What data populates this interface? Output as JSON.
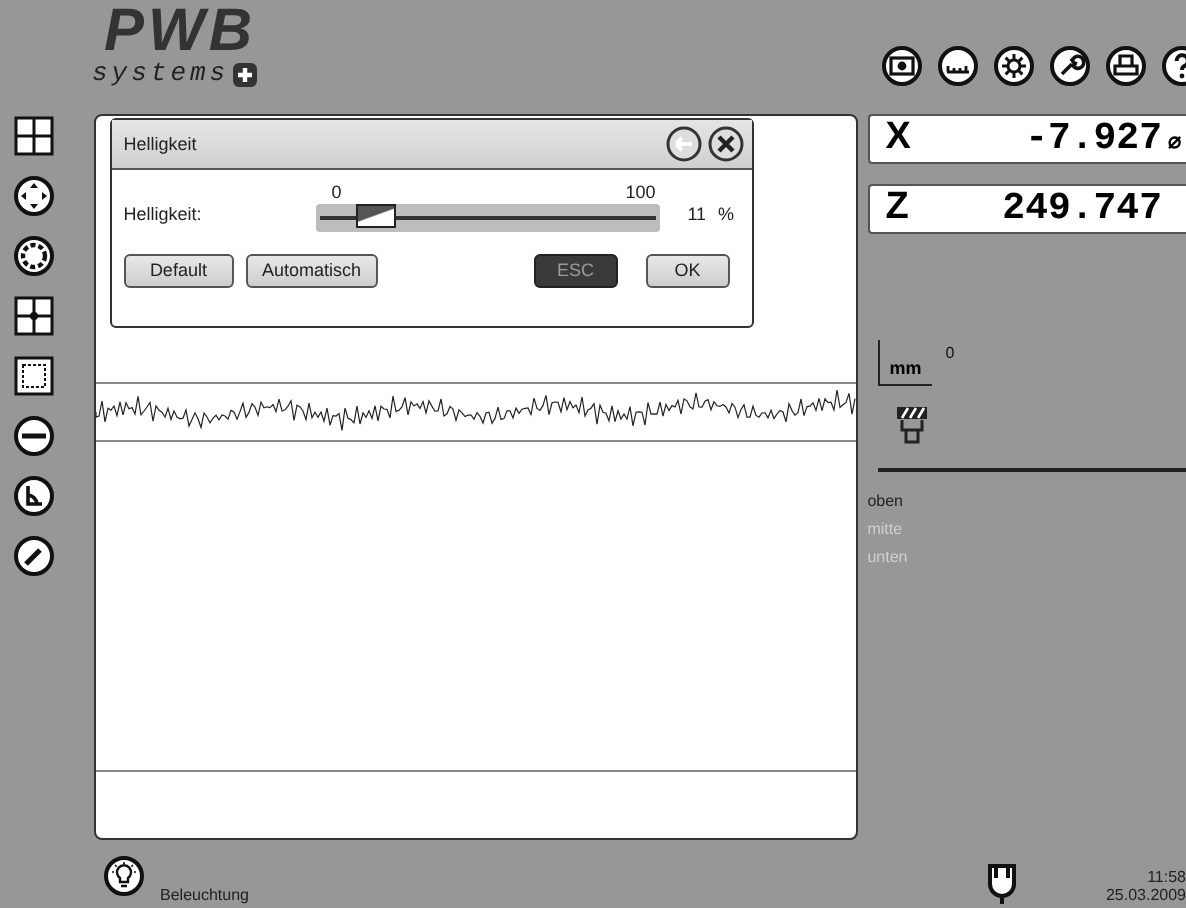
{
  "logo": {
    "brand": "PWB",
    "sub": "systems"
  },
  "dialog": {
    "title": "Helligkeit",
    "slider": {
      "label": "Helligkeit:",
      "min_label": "0",
      "max_label": "100",
      "level": 0.11,
      "reading": "11",
      "unit": "%"
    },
    "buttons": [
      {
        "label": "Default",
        "active": false
      },
      {
        "label": "Automatisch",
        "active": false
      },
      {
        "label": "ESC",
        "active": true
      },
      {
        "label": "OK",
        "active": false
      }
    ]
  },
  "readouts": [
    {
      "axis": "X",
      "value": "-7.927",
      "suffix": "⌀"
    },
    {
      "axis": "Z",
      "value": "249.747"
    }
  ],
  "unit": {
    "label": "mm",
    "exponent": "0"
  },
  "positions": [
    {
      "label": "oben",
      "selected": true
    },
    {
      "label": "mitte",
      "selected": false
    },
    {
      "label": "unten",
      "selected": false
    }
  ],
  "status": {
    "label": "Beleuchtung",
    "time": "11:58",
    "date": "25.03.2009"
  }
}
